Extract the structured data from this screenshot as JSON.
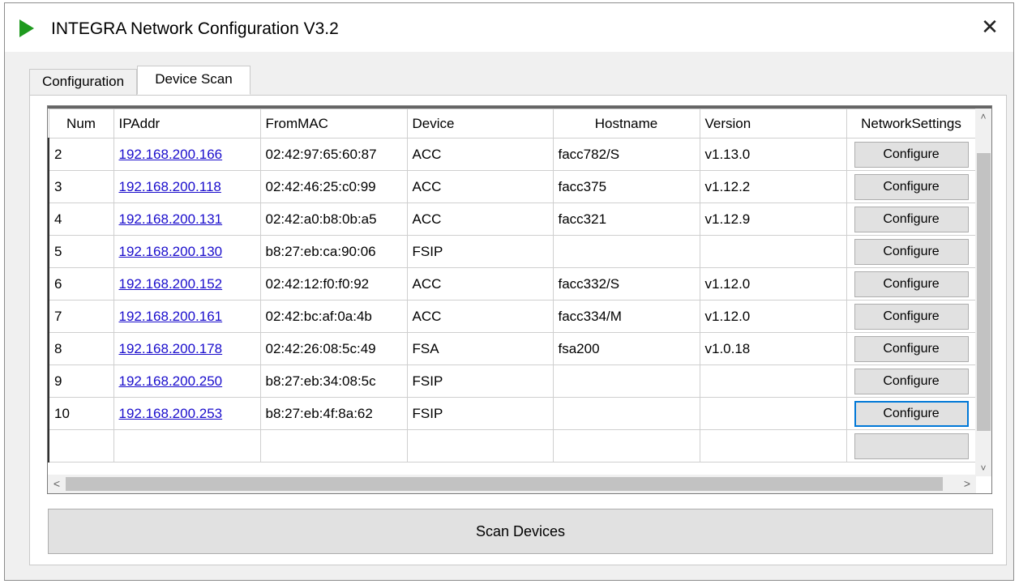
{
  "window": {
    "title": "INTEGRA Network Configuration V3.2",
    "icon": "green-play-icon",
    "accent_color": "#1f9a1f",
    "close_symbol": "✕"
  },
  "tabs": [
    {
      "label": "Configuration",
      "active": false
    },
    {
      "label": "Device Scan",
      "active": true
    }
  ],
  "grid": {
    "columns": [
      "Num",
      "IPAddr",
      "FromMAC",
      "Device",
      "Hostname",
      "Version",
      "NetworkSettings"
    ],
    "rows": [
      {
        "num": "2",
        "ip": "192.168.200.166",
        "mac": "02:42:97:65:60:87",
        "device": "ACC",
        "hostname": "facc782/S",
        "version": "v1.13.0",
        "action": "Configure"
      },
      {
        "num": "3",
        "ip": "192.168.200.118",
        "mac": "02:42:46:25:c0:99",
        "device": "ACC",
        "hostname": "facc375",
        "version": "v1.12.2",
        "action": "Configure"
      },
      {
        "num": "4",
        "ip": "192.168.200.131",
        "mac": "02:42:a0:b8:0b:a5",
        "device": "ACC",
        "hostname": "facc321",
        "version": "v1.12.9",
        "action": "Configure"
      },
      {
        "num": "5",
        "ip": "192.168.200.130",
        "mac": "b8:27:eb:ca:90:06",
        "device": "FSIP",
        "hostname": "",
        "version": "",
        "action": "Configure"
      },
      {
        "num": "6",
        "ip": "192.168.200.152",
        "mac": "02:42:12:f0:f0:92",
        "device": "ACC",
        "hostname": "facc332/S",
        "version": "v1.12.0",
        "action": "Configure"
      },
      {
        "num": "7",
        "ip": "192.168.200.161",
        "mac": "02:42:bc:af:0a:4b",
        "device": "ACC",
        "hostname": "facc334/M",
        "version": "v1.12.0",
        "action": "Configure"
      },
      {
        "num": "8",
        "ip": "192.168.200.178",
        "mac": "02:42:26:08:5c:49",
        "device": "FSA",
        "hostname": "fsa200",
        "version": "v1.0.18",
        "action": "Configure"
      },
      {
        "num": "9",
        "ip": "192.168.200.250",
        "mac": "b8:27:eb:34:08:5c",
        "device": "FSIP",
        "hostname": "",
        "version": "",
        "action": "Configure"
      },
      {
        "num": "10",
        "ip": "192.168.200.253",
        "mac": "b8:27:eb:4f:8a:62",
        "device": "FSIP",
        "hostname": "",
        "version": "",
        "action": "Configure"
      }
    ],
    "scroll_up_symbol": "˄",
    "scroll_down_symbol": "˅",
    "scroll_left_symbol": "<",
    "scroll_right_symbol": ">"
  },
  "scan_button": {
    "label": "Scan Devices"
  }
}
